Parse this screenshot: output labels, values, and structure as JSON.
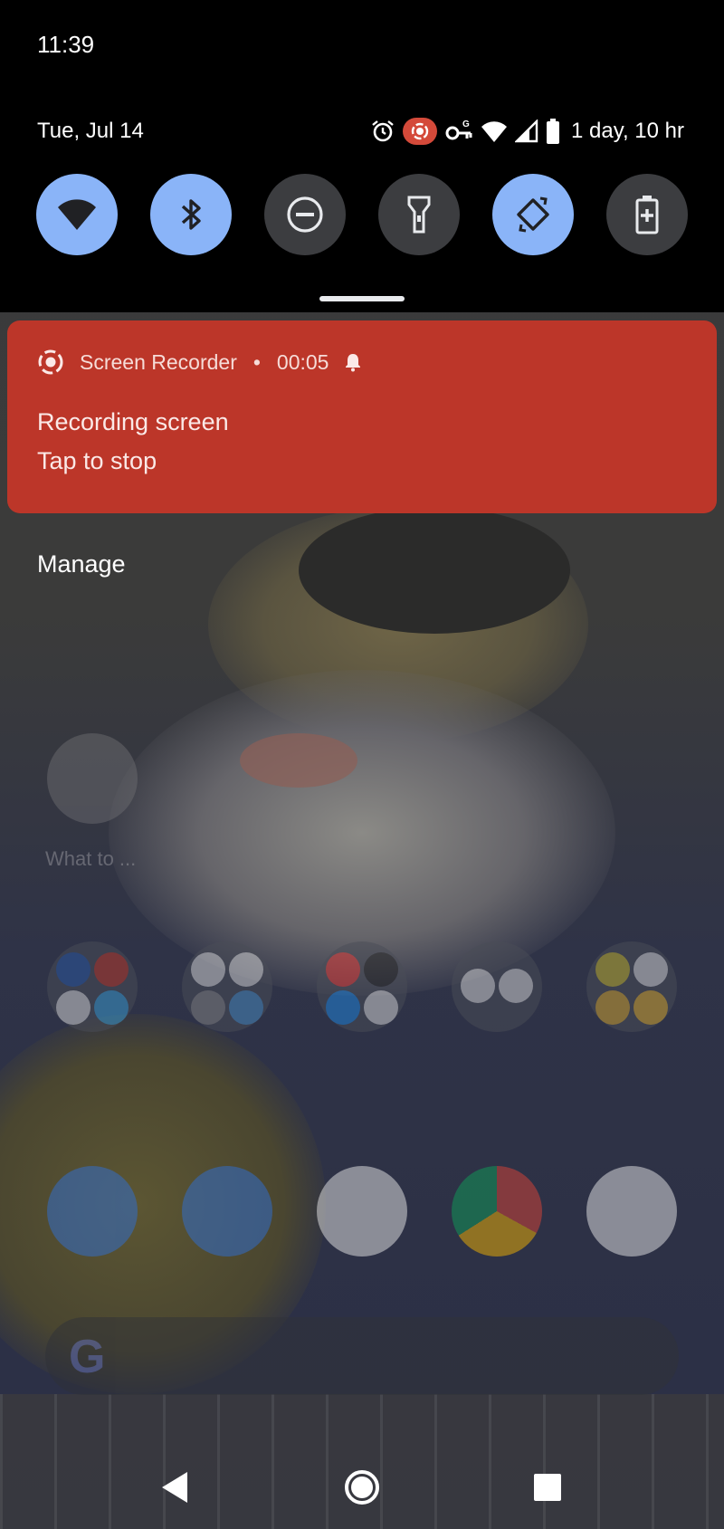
{
  "status_bar": {
    "time": "11:39",
    "date": "Tue, Jul 14",
    "battery_text": "1 day, 10 hr",
    "icons": [
      "alarm-icon",
      "screen-record-icon",
      "vpn-key-icon",
      "wifi-icon",
      "cell-signal-icon",
      "battery-icon"
    ]
  },
  "quick_settings": {
    "tiles": [
      {
        "name": "wifi",
        "state": "on"
      },
      {
        "name": "bluetooth",
        "state": "on"
      },
      {
        "name": "do-not-disturb",
        "state": "off"
      },
      {
        "name": "flashlight",
        "state": "off"
      },
      {
        "name": "auto-rotate",
        "state": "on"
      },
      {
        "name": "battery-saver",
        "state": "off"
      }
    ],
    "active_color": "#8ab4f8",
    "inactive_color": "#3c3d40"
  },
  "notification": {
    "app": "Screen Recorder",
    "separator": "•",
    "elapsed": "00:05",
    "title": "Recording screen",
    "text": "Tap to stop",
    "color": "#bc3629"
  },
  "manage_label": "Manage",
  "home": {
    "widget_text": "What to ..."
  }
}
